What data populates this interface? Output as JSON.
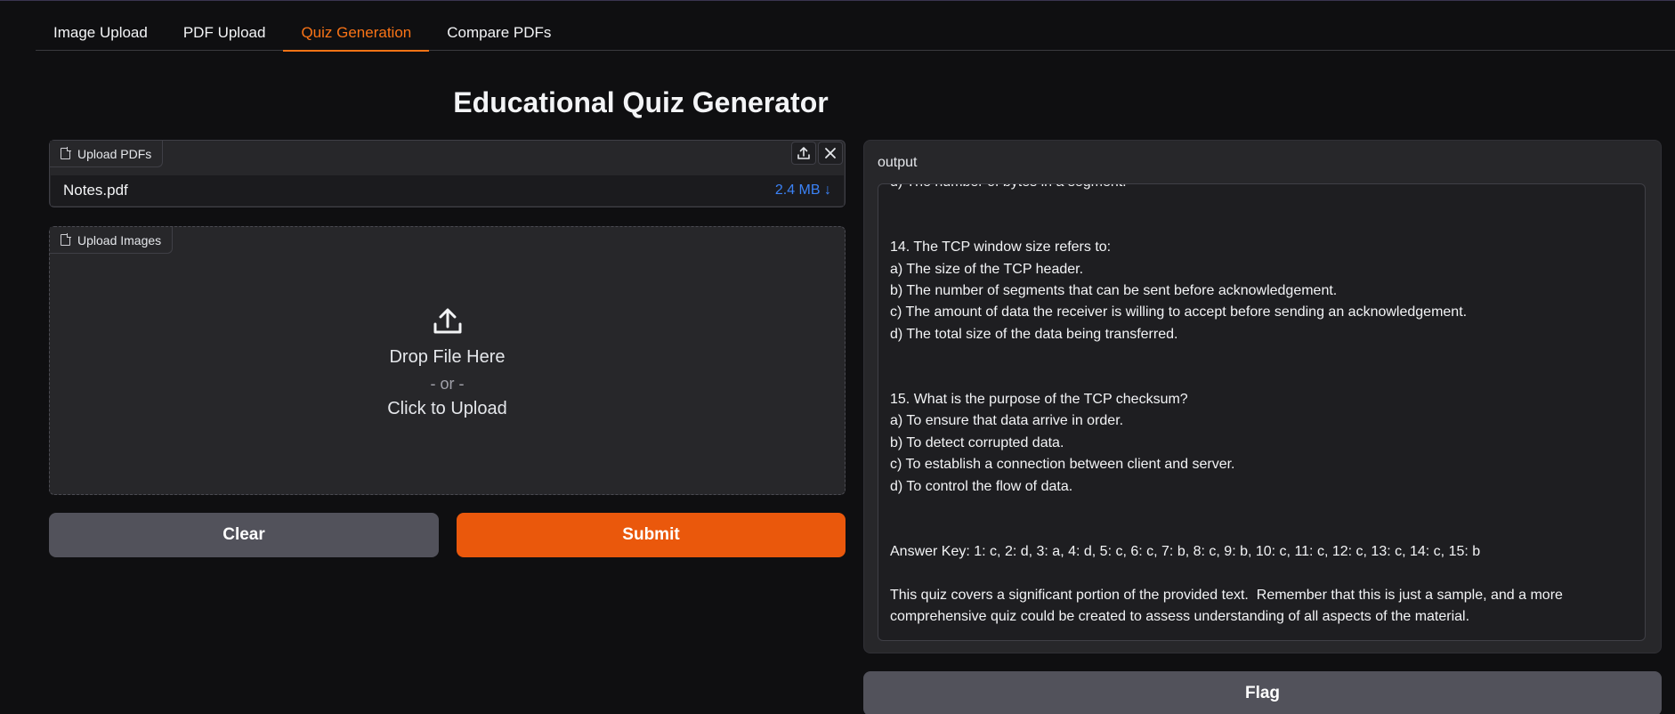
{
  "tabs": [
    {
      "label": "Image Upload"
    },
    {
      "label": "PDF Upload"
    },
    {
      "label": "Quiz Generation",
      "active": true
    },
    {
      "label": "Compare PDFs"
    }
  ],
  "page_title": "Educational Quiz Generator",
  "pdf_upload": {
    "label": "Upload PDFs",
    "file_name": "Notes.pdf",
    "file_size": "2.4 MB ↓"
  },
  "image_upload": {
    "label": "Upload Images",
    "drop_text": "Drop File Here",
    "or_text": "- or -",
    "click_text": "Click to Upload"
  },
  "buttons": {
    "clear": "Clear",
    "submit": "Submit",
    "flag": "Flag"
  },
  "output": {
    "label": "output",
    "text": "d) The number of bytes in a segment.\n\n\n14. The TCP window size refers to:\na) The size of the TCP header.\nb) The number of segments that can be sent before acknowledgement.\nc) The amount of data the receiver is willing to accept before sending an acknowledgement.\nd) The total size of the data being transferred.\n\n\n15. What is the purpose of the TCP checksum?\na) To ensure that data arrive in order.\nb) To detect corrupted data.\nc) To establish a connection between client and server.\nd) To control the flow of data.\n\n\nAnswer Key: 1: c, 2: d, 3: a, 4: d, 5: c, 6: c, 7: b, 8: c, 9: b, 10: c, 11: c, 12: c, 13: c, 14: c, 15: b\n\nThis quiz covers a significant portion of the provided text.  Remember that this is just a sample, and a more comprehensive quiz could be created to assess understanding of all aspects of the material."
  },
  "colors": {
    "accent": "#ea580c",
    "link": "#3b82f6",
    "background": "#0f0f11",
    "panel": "#27272a"
  }
}
